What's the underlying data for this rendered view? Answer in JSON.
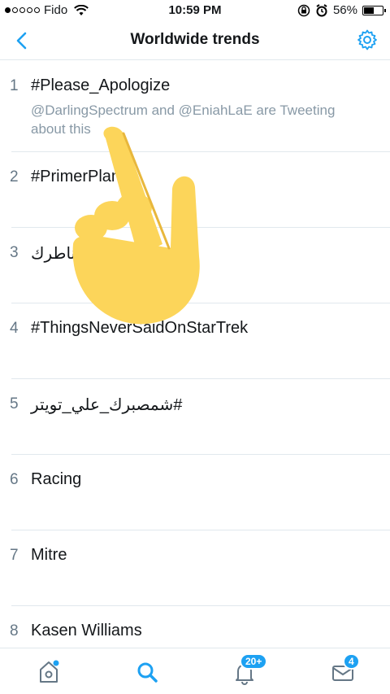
{
  "status_bar": {
    "carrier": "Fido",
    "time": "10:59 PM",
    "battery": "56%",
    "battery_level": 0.56
  },
  "nav": {
    "title": "Worldwide trends",
    "back_icon": "chevron-left-icon",
    "settings_icon": "gear-icon"
  },
  "trends": [
    {
      "rank": "1",
      "name": "#Please_Apologize",
      "description": "@DarlingSpectrum and @EniahLaE are Tweeting about this"
    },
    {
      "rank": "2",
      "name": "#PrimerPlan"
    },
    {
      "rank": "3",
      "name": "ناطرك"
    },
    {
      "rank": "4",
      "name": "#ThingsNeverSaidOnStarTrek"
    },
    {
      "rank": "5",
      "name": "#شمصبرك_علي_تويتر"
    },
    {
      "rank": "6",
      "name": "Racing"
    },
    {
      "rank": "7",
      "name": "Mitre"
    },
    {
      "rank": "8",
      "name": "Kasen Williams"
    }
  ],
  "tab_bar": {
    "home_icon": "home-icon",
    "search_icon": "search-icon",
    "notifications_icon": "bell-icon",
    "notifications_badge": "20+",
    "messages_icon": "mail-icon",
    "messages_badge": "4"
  },
  "colors": {
    "accent": "#1da1f2",
    "text": "#14171a",
    "secondary": "#657786",
    "hand": "#fcd55a"
  }
}
